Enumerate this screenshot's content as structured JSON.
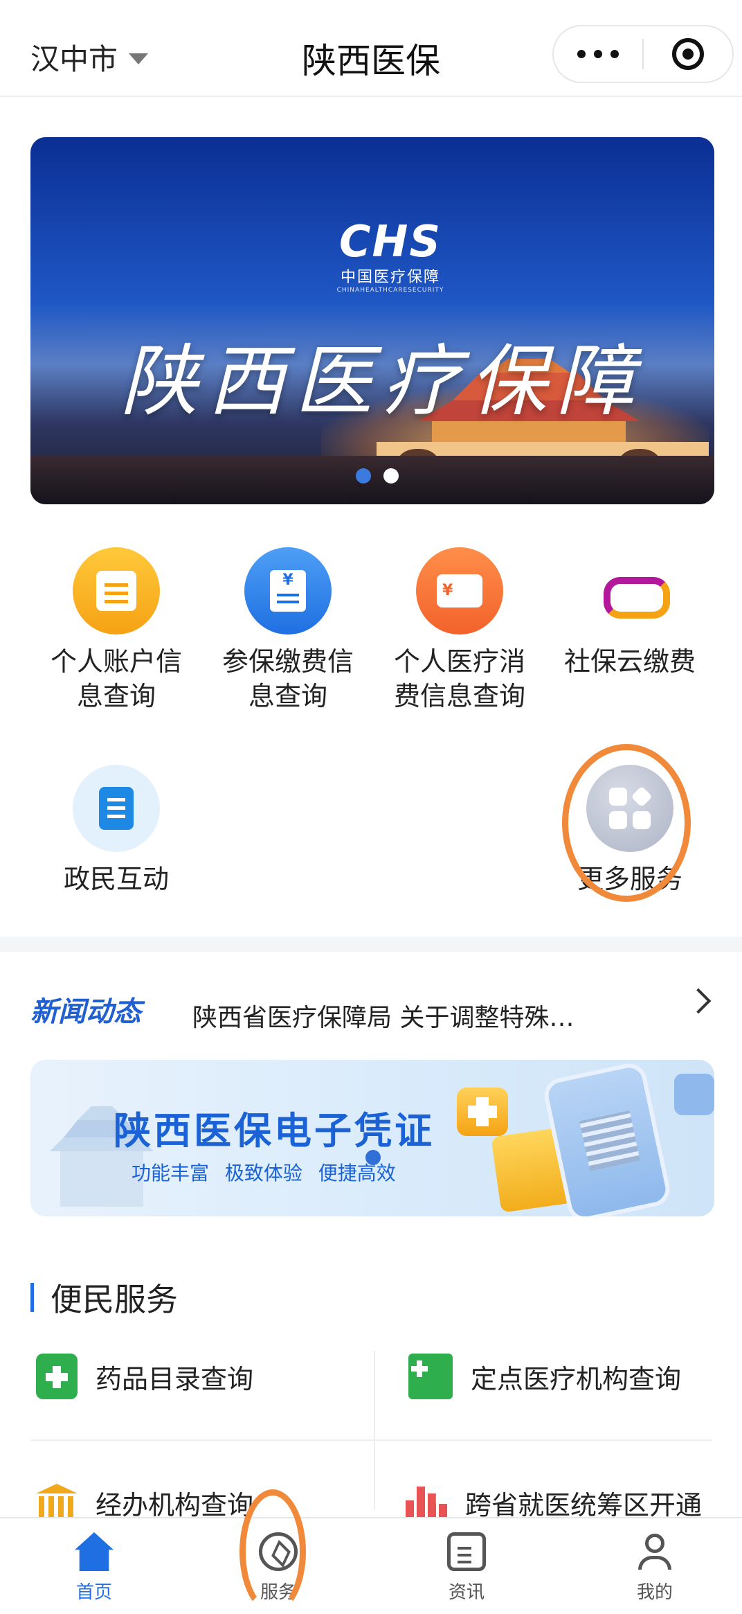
{
  "header": {
    "city": "汉中市",
    "title": "陕西医保",
    "capsule_more_icon": "more-dots-icon",
    "capsule_close_icon": "close-target-icon"
  },
  "banner": {
    "logo_mark": "CHS",
    "logo_name": "中国医疗保障",
    "logo_en": "CHINAHEALTHCARESECURITY",
    "headline": "陕西医疗保障",
    "slide_count": 2,
    "active_slide": 1
  },
  "quick": {
    "items": [
      {
        "line1": "个人账户信",
        "line2": "息查询",
        "icon": "account-doc-icon"
      },
      {
        "line1": "参保缴费信",
        "line2": "息查询",
        "icon": "payment-bill-icon"
      },
      {
        "line1": "个人医疗消",
        "line2": "费信息查询",
        "icon": "wallet-icon"
      },
      {
        "line1": "社保云缴费",
        "line2": "",
        "icon": "cloud-pay-icon"
      },
      {
        "line1": "政民互动",
        "line2": "",
        "icon": "interaction-icon"
      },
      {
        "line1": "更多服务",
        "line2": "",
        "icon": "apps-grid-icon"
      }
    ]
  },
  "news": {
    "tag": "新闻动态",
    "headline": "陕西省医疗保障局 关于调整特殊…"
  },
  "ecert": {
    "title": "陕西医保电子凭证",
    "subtitle": "功能丰富  极致体验  便捷高效"
  },
  "services": {
    "title": "便民服务",
    "items": [
      {
        "label": "药品目录查询",
        "icon": "drug-box-icon"
      },
      {
        "label": "定点医疗机构查询",
        "icon": "hospital-icon"
      },
      {
        "label": "经办机构查询",
        "icon": "government-building-icon"
      },
      {
        "label": "跨省就医统筹区开通",
        "icon": "bar-chart-icon"
      }
    ]
  },
  "tabbar": {
    "tabs": [
      {
        "label": "首页",
        "icon": "home-icon",
        "active": true
      },
      {
        "label": "服务",
        "icon": "compass-icon",
        "active": false
      },
      {
        "label": "资讯",
        "icon": "news-doc-icon",
        "active": false
      },
      {
        "label": "我的",
        "icon": "user-icon",
        "active": false
      }
    ]
  },
  "colors": {
    "accent": "#1f6fe2",
    "annotation": "#f08a3a"
  }
}
